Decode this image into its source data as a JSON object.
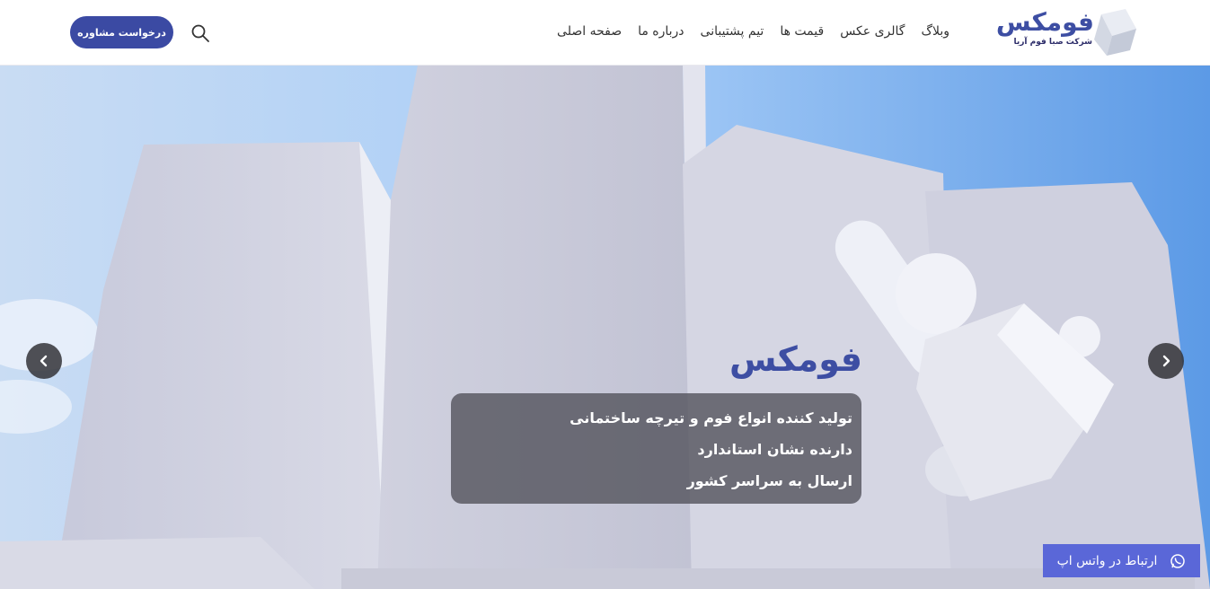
{
  "logo": {
    "name": "فومکس",
    "tagline": "شرکت صبا فوم آریا"
  },
  "nav": {
    "items": [
      {
        "label": "صفحه اصلی"
      },
      {
        "label": "درباره ما"
      },
      {
        "label": "تیم پشتیبانی"
      },
      {
        "label": "قیمت ها"
      },
      {
        "label": "گالری عکس"
      },
      {
        "label": "وبلاگ"
      }
    ]
  },
  "header": {
    "consult_label": "درخواست مشاوره",
    "search_icon": "search-icon"
  },
  "hero": {
    "title": "فومکس",
    "lines": [
      "تولید کننده انواع فوم و تیرچه ساختمانی",
      "دارنده نشان استاندارد",
      "ارسال به سراسر کشور"
    ],
    "prev_icon": "chevron-left-icon",
    "next_icon": "chevron-right-icon"
  },
  "whatsapp": {
    "label": "ارتباط در واتس اپ",
    "icon": "whatsapp-icon"
  },
  "colors": {
    "brand": "#3b4aa3",
    "whatsapp_button": "#5a67d8",
    "caption_bg": "#505058"
  }
}
